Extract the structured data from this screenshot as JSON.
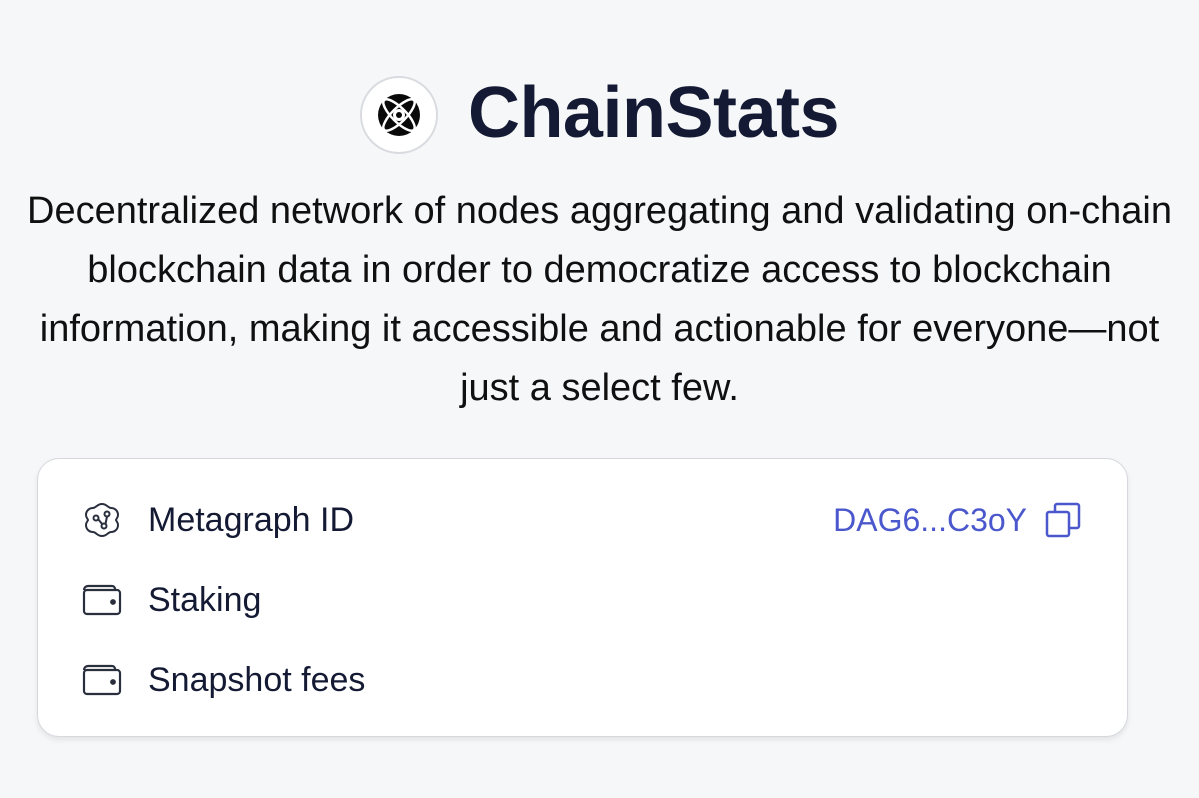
{
  "header": {
    "title": "ChainStats",
    "logo_icon": "chainstats-logo-icon"
  },
  "description": "Decentralized network of nodes aggregating and validating on-chain blockchain data in order to democratize access to blockchain information, making it accessible and actionable for everyone—not just a select few.",
  "card": {
    "rows": [
      {
        "label": "Metagraph ID",
        "icon": "metagraph-icon",
        "value": "DAG6...C3oY",
        "action_icon": "copy-icon"
      },
      {
        "label": "Staking",
        "icon": "wallet-icon"
      },
      {
        "label": "Snapshot fees",
        "icon": "wallet-icon"
      }
    ]
  },
  "colors": {
    "background": "#f6f7f9",
    "title": "#141a33",
    "accent_link": "#4b57cc",
    "card_border": "#d6d8dd"
  }
}
